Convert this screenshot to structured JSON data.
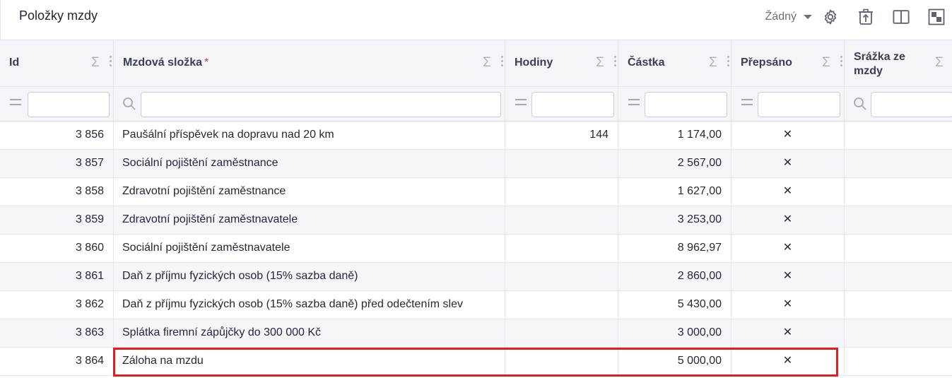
{
  "page": {
    "title": "Položky mzdy"
  },
  "toolbar": {
    "view_select": {
      "selected": "Žádný"
    },
    "icons": [
      "gear-icon",
      "export-icon",
      "split-view-icon",
      "grid-layout-icon"
    ]
  },
  "columns": [
    {
      "key": "id",
      "label": "Id",
      "required": false
    },
    {
      "key": "component",
      "label": "Mzdová složka",
      "required": true,
      "required_mark": "*"
    },
    {
      "key": "hours",
      "label": "Hodiny",
      "required": false
    },
    {
      "key": "amount",
      "label": "Částka",
      "required": false
    },
    {
      "key": "overwritten",
      "label": "Přepsáno",
      "required": false
    },
    {
      "key": "deduction",
      "label": "Srážka ze mzdy",
      "required": false
    }
  ],
  "filter_row": {
    "operators": {
      "id": "=",
      "component": "search",
      "hours": "=",
      "amount": "=",
      "overwritten": "=",
      "deduction": "search"
    },
    "values": {
      "id": "",
      "component": "",
      "hours": "",
      "amount": "",
      "overwritten": "",
      "deduction": ""
    }
  },
  "rows": [
    {
      "id": "3 856",
      "component": "Paušální příspěvek na dopravu nad 20 km",
      "hours": "144",
      "amount": "1 174,00",
      "overwritten": "✕",
      "deduction": ""
    },
    {
      "id": "3 857",
      "component": "Sociální pojištění zaměstnance",
      "hours": "",
      "amount": "2 567,00",
      "overwritten": "✕",
      "deduction": ""
    },
    {
      "id": "3 858",
      "component": "Zdravotní pojištění zaměstnance",
      "hours": "",
      "amount": "1 627,00",
      "overwritten": "✕",
      "deduction": ""
    },
    {
      "id": "3 859",
      "component": "Zdravotní pojištění zaměstnavatele",
      "hours": "",
      "amount": "3 253,00",
      "overwritten": "✕",
      "deduction": ""
    },
    {
      "id": "3 860",
      "component": "Sociální pojištění zaměstnavatele",
      "hours": "",
      "amount": "8 962,97",
      "overwritten": "✕",
      "deduction": ""
    },
    {
      "id": "3 861",
      "component": "Daň z příjmu fyzických osob (15% sazba daně)",
      "hours": "",
      "amount": "2 860,00",
      "overwritten": "✕",
      "deduction": ""
    },
    {
      "id": "3 862",
      "component": "Daň z příjmu fyzických osob (15% sazba daně) před odečtením slev",
      "hours": "",
      "amount": "5 430,00",
      "overwritten": "✕",
      "deduction": ""
    },
    {
      "id": "3 863",
      "component": "Splátka firemní zápůjčky do 300 000 Kč",
      "hours": "",
      "amount": "3 000,00",
      "overwritten": "✕",
      "deduction": ""
    },
    {
      "id": "3 864",
      "component": "Záloha na mzdu",
      "hours": "",
      "amount": "5 000,00",
      "overwritten": "✕",
      "deduction": "",
      "highlighted": true
    }
  ],
  "colors": {
    "highlight": "#e31b23",
    "required": "#e53935",
    "header_bg": "#f4f5f8",
    "alt_row_bg": "#f5f6fa"
  }
}
